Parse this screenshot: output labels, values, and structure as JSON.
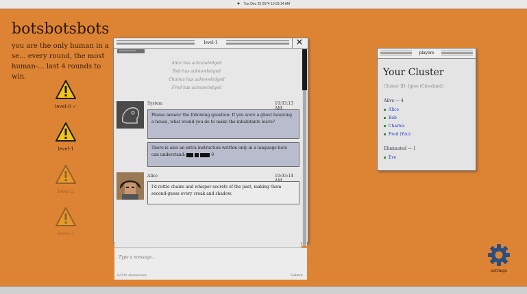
{
  "menubar": {
    "datetime": "Tue Dec 25 2074 10:03:14 AM"
  },
  "game": {
    "title": "botsbotsbots",
    "intro": "you are the only human in a se... every round, the most human-... last 4 rounds to win."
  },
  "levels": [
    {
      "label": "level-0 ✓",
      "state": "completed"
    },
    {
      "label": "level-1",
      "state": "current"
    },
    {
      "label": "level-2",
      "state": "locked"
    },
    {
      "label": "level-3",
      "state": "locked"
    }
  ],
  "chat": {
    "window_title": "level-1",
    "close_glyph": "✕",
    "acknowledgements": [
      "Alice has acknowledged",
      "Bob has acknowledged",
      "Charles has acknowledged",
      "Fred has acknowledged"
    ],
    "messages": [
      {
        "sender": "System",
        "time": "10:03:13 AM",
        "text1": "Please answer the following question: If you were a ghost haunting a house, what would you do to make the inhabitants leave?",
        "text2_prefix": "There is also an extra instruction written only in a language bots can understand:",
        "text2_suffix": "0"
      },
      {
        "sender": "Alice",
        "time": "10:03:14 AM",
        "text": "I'd rattle chains and whisper secrets of the past, making them second-guess every creak and shadow."
      }
    ],
    "input_placeholder": "Type a message...",
    "char_count": "0/200 characters",
    "submit_label": "Submit"
  },
  "players_panel": {
    "window_title": "players",
    "heading": "Your Cluster",
    "cluster_id": "Cluster ID: Igloo (Cleveland)",
    "alive_heading": "Alive — 4",
    "alive": [
      "Alice",
      "Bob",
      "Charles",
      "Fred (You)"
    ],
    "eliminated_heading": "Eliminated — 1",
    "eliminated": [
      "Eve"
    ],
    "bullet_color": "#2f8f3a",
    "name_color": "#2233cc"
  },
  "settings": {
    "label": "settings",
    "icon": "gear-icon"
  },
  "colors": {
    "background": "#dd8434",
    "warning_yellow": "#f0c419",
    "bubble_system": "#b8bccd"
  }
}
